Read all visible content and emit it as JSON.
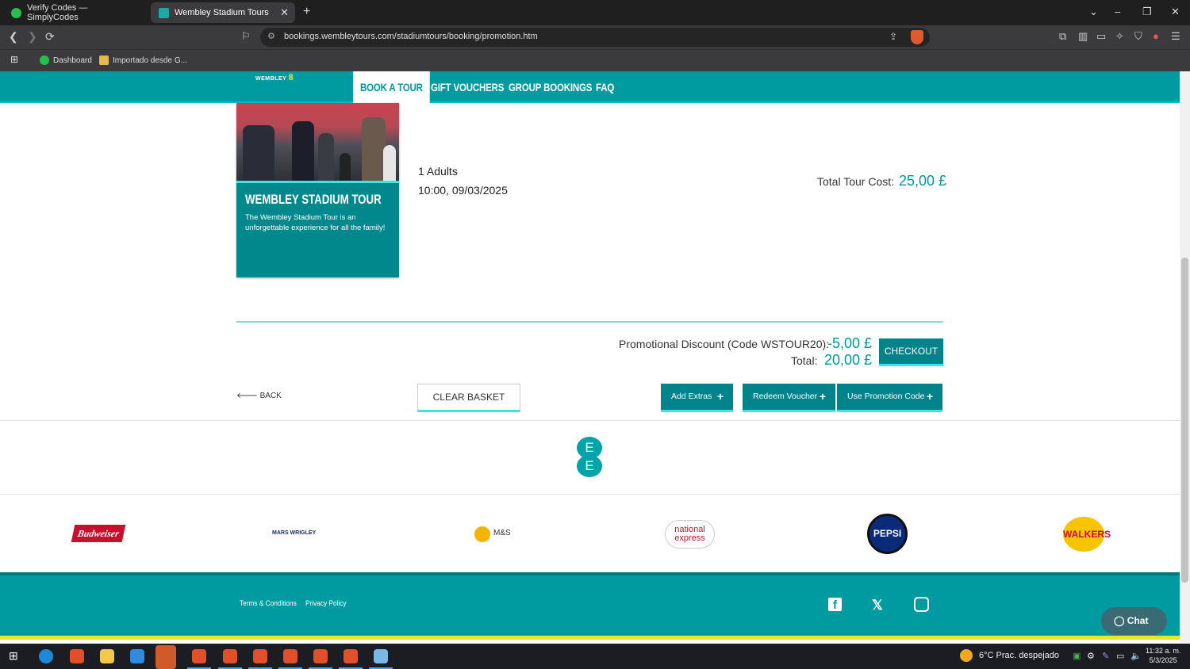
{
  "browser": {
    "tabs": [
      {
        "title": "Verify Codes — SimplyCodes",
        "active": false
      },
      {
        "title": "Wembley Stadium Tours",
        "active": true
      }
    ],
    "url": "bookings.wembleytours.com/stadiumtours/booking/promotion.htm",
    "bookmarks": [
      "Dashboard",
      "Importado desde G..."
    ],
    "new_tab": "+",
    "window_controls": [
      "⌄",
      "–",
      "❐",
      "✕"
    ]
  },
  "site": {
    "logo_text": "WEMBLEY",
    "logo_mark": "8",
    "nav": [
      "BOOK A TOUR",
      "GIFT VOUCHERS",
      "GROUP BOOKINGS",
      "FAQ"
    ]
  },
  "booking": {
    "card_title": "WEMBLEY STADIUM TOUR",
    "card_desc": "The Wembley Stadium Tour is an unforgettable experience for all the family!",
    "adults": "1 Adults",
    "datetime": "10:00, 09/03/2025",
    "total_cost_label": "Total Tour Cost:",
    "total_cost_value": "25,00 £",
    "promo_label": "Promotional Discount (Code WSTOUR20):",
    "promo_value": "-5,00 £",
    "total_label": "Total:",
    "total_value": "20,00 £"
  },
  "actions": {
    "checkout": "CHECKOUT",
    "back": "BACK",
    "clear_basket": "CLEAR BASKET",
    "add_extras": "Add Extras",
    "redeem_voucher": "Redeem Voucher",
    "use_promo": "Use Promotion Code"
  },
  "sponsors": [
    "Budweiser",
    "MARS WRIGLEY",
    "M&S",
    "national express",
    "PEPSI",
    "WALKERS"
  ],
  "partner_logo": [
    "E",
    "E"
  ],
  "footer": {
    "links": [
      "Terms & Conditions",
      "Privacy Policy"
    ],
    "social": [
      "facebook-icon",
      "x-icon",
      "instagram-icon"
    ]
  },
  "chat_label": "Chat",
  "taskbar": {
    "weather": "6°C  Prac. despejado",
    "time": "11:32 a. m.",
    "date": "5/3/2025"
  },
  "colors": {
    "brand_teal": "#009ba1",
    "accent_cyan": "#3ae6e0",
    "accent_yellow": "#e3ea23"
  }
}
